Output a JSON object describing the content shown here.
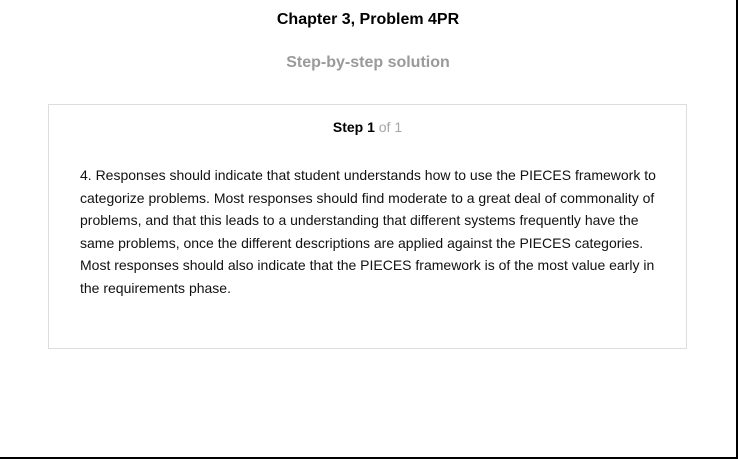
{
  "header": {
    "title": "Chapter 3, Problem 4PR",
    "subtitle": "Step-by-step solution"
  },
  "step": {
    "label": "Step 1",
    "count": "of 1",
    "body": "4. Responses should indicate that student understands how to use the PIECES framework to categorize problems. Most responses should find moderate to a great deal of commonality of problems, and that this leads to a understanding that different systems frequently have the same problems, once the different descriptions are applied against the PIECES categories. Most responses should also indicate that the PIECES framework is of the most value early in the requirements phase."
  },
  "colors": {
    "title": "#000000",
    "subtitle": "#9a9a9a",
    "step_count": "#a6a6a6",
    "card_border": "#dddddd"
  }
}
